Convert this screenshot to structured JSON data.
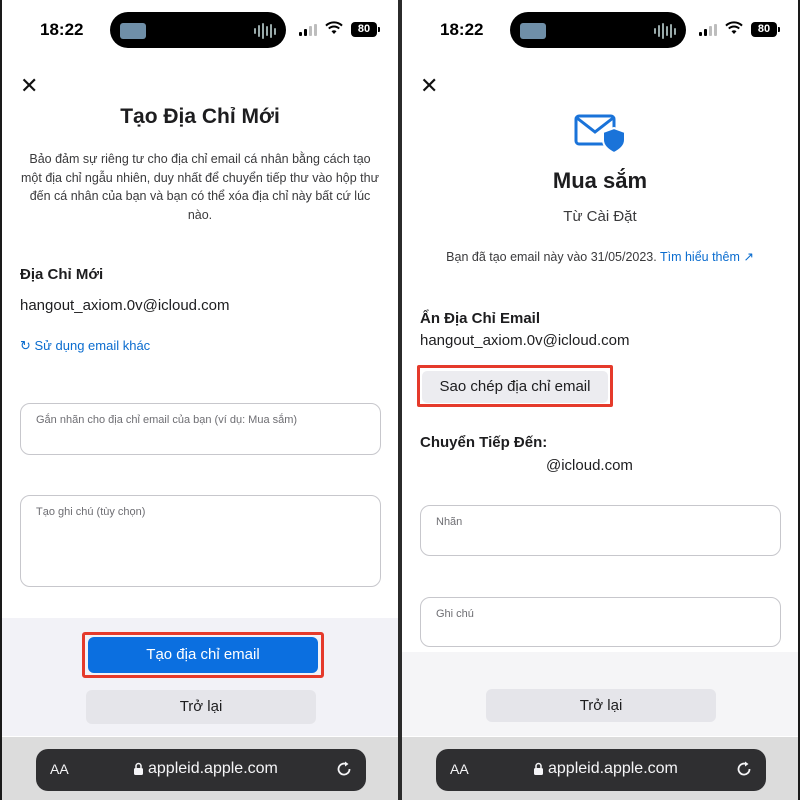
{
  "status_bar": {
    "time": "18:22",
    "battery": "80"
  },
  "left": {
    "title": "Tạo Địa Chỉ Mới",
    "description": "Bảo đảm sự riêng tư cho địa chỉ email cá nhân bằng cách tạo một địa chỉ ngẫu nhiên, duy nhất để chuyển tiếp thư vào hộp thư đến cá nhân của bạn và bạn có thể xóa địa chỉ này bất cứ lúc nào.",
    "new_address_label": "Địa Chỉ Mới",
    "email": "hangout_axiom.0v@icloud.com",
    "use_other_link": "Sử dụng email khác",
    "label_placeholder": "Gắn nhãn cho địa chỉ email của bạn (ví dụ: Mua sắm)",
    "note_placeholder": "Tạo ghi chú (tùy chọn)",
    "create_button": "Tạo địa chỉ email",
    "back_button": "Trở lại"
  },
  "right": {
    "title": "Mua sắm",
    "subtitle": "Từ Cài Đặt",
    "created_text": "Bạn đã tạo email này vào 31/05/2023.",
    "learn_more": "Tìm hiểu thêm ↗",
    "hide_email_label": "Ẩn Địa Chỉ Email",
    "email": "hangout_axiom.0v@icloud.com",
    "copy_button": "Sao chép địa chỉ email",
    "forward_label": "Chuyển Tiếp Đến:",
    "forward_email": "@icloud.com",
    "label_field": "Nhãn",
    "note_field": "Ghi chú",
    "back_button": "Trở lại"
  },
  "browser": {
    "text_size": "AA",
    "url": "appleid.apple.com"
  },
  "colors": {
    "accent": "#0b6fe0",
    "highlight": "#e53a2b",
    "link": "#0a6ccf"
  },
  "icons": [
    "close-icon",
    "refresh-icon",
    "mail-shield-icon",
    "lock-icon",
    "reload-icon",
    "wifi-icon",
    "signal-icon",
    "external-link-icon"
  ]
}
